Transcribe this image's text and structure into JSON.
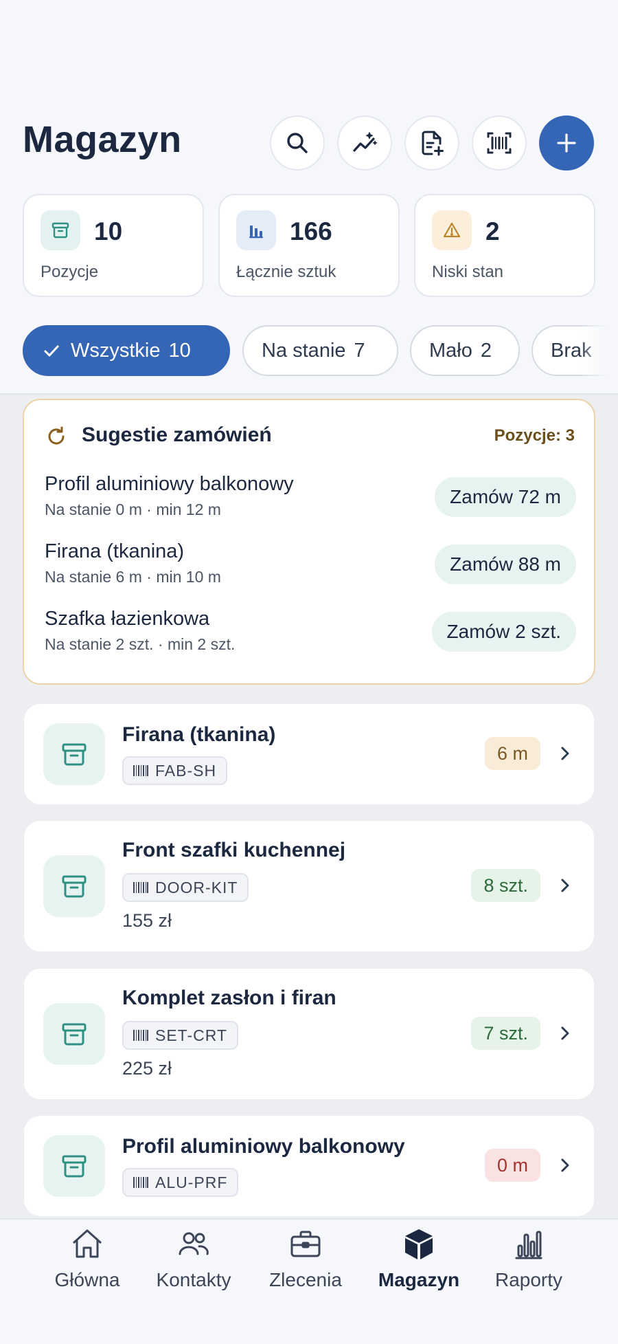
{
  "header": {
    "title": "Magazyn",
    "actions": [
      {
        "name": "search",
        "icon": "search-icon"
      },
      {
        "name": "analytics",
        "icon": "sparkle-trend-icon"
      },
      {
        "name": "new-document",
        "icon": "file-plus-icon"
      },
      {
        "name": "barcode-scan",
        "icon": "barcode-scan-icon"
      },
      {
        "name": "add",
        "icon": "plus-icon"
      }
    ]
  },
  "stats": [
    {
      "value": "10",
      "label": "Pozycje",
      "icon": "archive-icon",
      "color": "#2f8f84"
    },
    {
      "value": "166",
      "label": "Łącznie sztuk",
      "icon": "bars-icon",
      "color": "#3565b5"
    },
    {
      "value": "2",
      "label": "Niski stan",
      "icon": "warning-icon",
      "color": "#b9842c"
    }
  ],
  "filters": [
    {
      "label": "Wszystkie",
      "count": "10",
      "active": true
    },
    {
      "label": "Na stanie",
      "count": "7",
      "active": false
    },
    {
      "label": "Mało",
      "count": "2",
      "active": false
    },
    {
      "label": "Brak",
      "count": "",
      "active": false
    }
  ],
  "suggestions": {
    "title": "Sugestie zamówień",
    "count_label": "Pozycje: 3",
    "items": [
      {
        "name": "Profil aluminiowy balkonowy",
        "sub": "Na stanie 0 m · min 12 m",
        "action": "Zamów 72 m"
      },
      {
        "name": "Firana (tkanina)",
        "sub": "Na stanie 6 m · min 10 m",
        "action": "Zamów 88 m"
      },
      {
        "name": "Szafka łazienkowa",
        "sub": "Na stanie 2 szt. · min 2 szt.",
        "action": "Zamów 2 szt."
      }
    ]
  },
  "items": [
    {
      "name": "Firana (tkanina)",
      "sku": "FAB-SH",
      "price": "",
      "qty": "6 m",
      "status": "warn"
    },
    {
      "name": "Front szafki kuchennej",
      "sku": "DOOR-KIT",
      "price": "155 zł",
      "qty": "8 szt.",
      "status": "ok"
    },
    {
      "name": "Komplet zasłon i firan",
      "sku": "SET-CRT",
      "price": "225 zł",
      "qty": "7 szt.",
      "status": "ok"
    },
    {
      "name": "Profil aluminiowy balkonowy",
      "sku": "ALU-PRF",
      "price": "",
      "qty": "0 m",
      "status": "bad"
    }
  ],
  "nav": [
    {
      "label": "Główna",
      "icon": "home-icon",
      "active": false
    },
    {
      "label": "Kontakty",
      "icon": "users-icon",
      "active": false
    },
    {
      "label": "Zlecenia",
      "icon": "briefcase-icon",
      "active": false
    },
    {
      "label": "Magazyn",
      "icon": "box-icon",
      "active": true
    },
    {
      "label": "Raporty",
      "icon": "chart-icon",
      "active": false
    }
  ],
  "colors": {
    "accent": "#3565b5",
    "teal": "#2f8f84",
    "warning_border": "#ecd3a6"
  }
}
